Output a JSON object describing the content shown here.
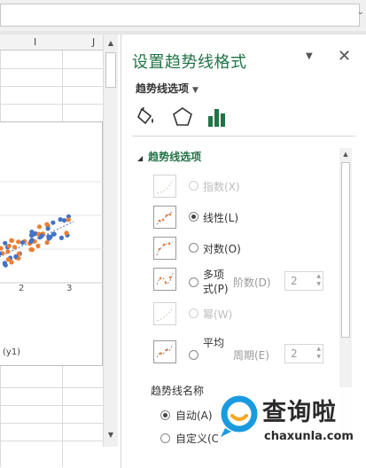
{
  "sheet": {
    "columns": [
      "I",
      "J"
    ],
    "chart": {
      "x_ticks": [
        "2",
        "3"
      ],
      "legend_text": "(y1)"
    }
  },
  "pane": {
    "title": "设置趋势线格式",
    "options_dropdown": "趋势线选项",
    "tabs": [
      "fill-bucket-icon",
      "pentagon-icon",
      "bar-chart-icon"
    ],
    "section": "趋势线选项",
    "trend_types": [
      {
        "label": "指数(X)",
        "enabled": false,
        "selected": false
      },
      {
        "label": "线性(L)",
        "enabled": true,
        "selected": true
      },
      {
        "label": "对数(O)",
        "enabled": true,
        "selected": false
      },
      {
        "label": "多项式(P)",
        "label_line1": "多项",
        "label_line2": "式(P)",
        "enabled": true,
        "selected": false,
        "param_label": "阶数(D)",
        "param_value": "2"
      },
      {
        "label": "幂(W)",
        "enabled": false,
        "selected": false
      },
      {
        "label": "移动平均(M)",
        "label_line1": "平均",
        "enabled": true,
        "selected": false,
        "param_label": "周期(E)",
        "param_value": "2"
      }
    ],
    "trendline_name": {
      "header": "趋势线名称",
      "options": [
        {
          "label": "自动(A)",
          "selected": true
        },
        {
          "label": "自定义(C)",
          "selected": false
        }
      ]
    }
  },
  "watermark": {
    "brand": "查询啦",
    "url": "chaxunla.com"
  },
  "colors": {
    "accent_green": "#217346",
    "series_blue": "#4472c4",
    "series_orange": "#ed7d31"
  }
}
